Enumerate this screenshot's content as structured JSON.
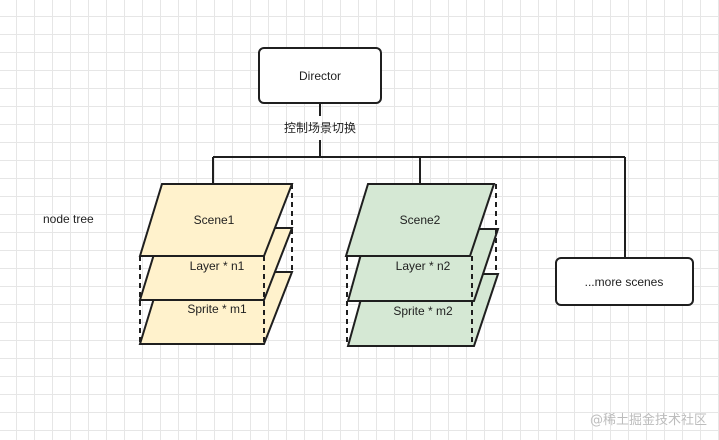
{
  "diagram": {
    "root": {
      "label": "Director"
    },
    "edge_label": "控制场景切换",
    "side_label": "node tree",
    "scenes": [
      {
        "color": "#fff2cc",
        "layers": [
          "Scene1",
          "Layer * n1",
          "Sprite * m1"
        ]
      },
      {
        "color": "#d5e8d4",
        "layers": [
          "Scene2",
          "Layer * n2",
          "Sprite * m2"
        ]
      }
    ],
    "more": {
      "label": "...more scenes"
    }
  },
  "watermark": "@稀土掘金技术社区"
}
